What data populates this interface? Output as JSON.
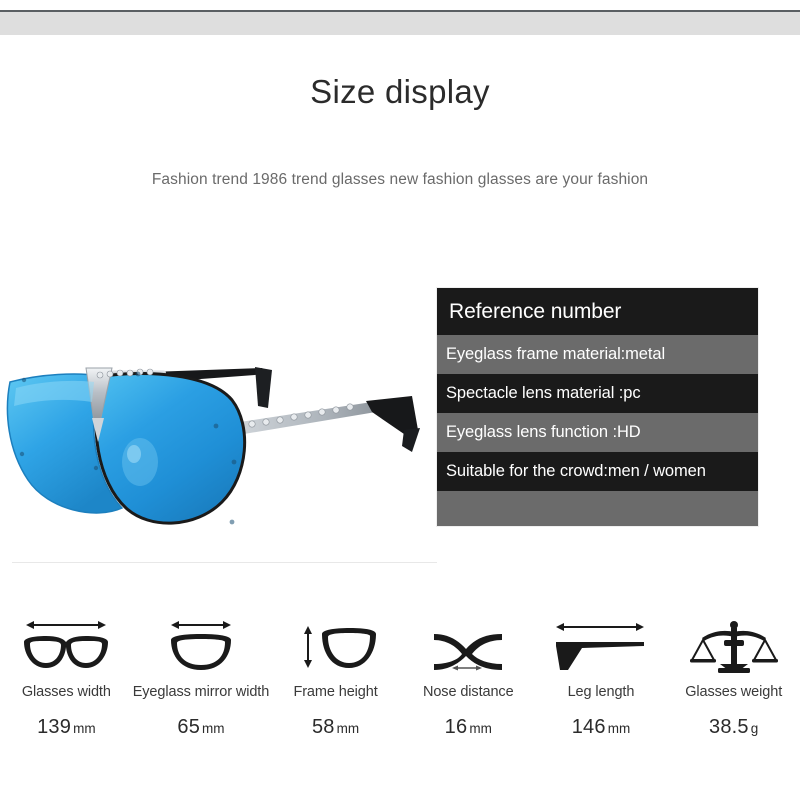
{
  "header": {
    "title": "Size display",
    "subtitle": "Fashion trend 1986 trend glasses new fashion glasses are your fashion"
  },
  "product": {
    "name": "blue mirrored shield sunglasses",
    "lens_color": "#2e9fe0",
    "frame_color": "#c9ccd1",
    "temple_tip_color": "#141414"
  },
  "spec_panel": {
    "heading": "Reference number",
    "rows": [
      {
        "text": "Eyeglass frame material:metal",
        "style": "gray"
      },
      {
        "text": "Spectacle lens material :pc",
        "style": "dark"
      },
      {
        "text": "Eyeglass lens function  :HD",
        "style": "gray"
      },
      {
        "text": "Suitable for the crowd:men / women",
        "style": "dark"
      },
      {
        "text": "",
        "style": "gray"
      }
    ],
    "colors": {
      "dark_row": "#1a1a1a",
      "gray_row": "#6b6b6b",
      "text": "#ffffff"
    }
  },
  "measurements": [
    {
      "icon": "glasses-frame-width-icon",
      "label": "Glasses width",
      "value": "139",
      "unit": "mm"
    },
    {
      "icon": "eyeglass-lens-width-icon",
      "label": "Eyeglass mirror width",
      "value": "65",
      "unit": "mm"
    },
    {
      "icon": "frame-height-icon",
      "label": "Frame height",
      "value": "58",
      "unit": "mm"
    },
    {
      "icon": "nose-bridge-icon",
      "label": "Nose distance",
      "value": "16",
      "unit": "mm"
    },
    {
      "icon": "temple-arm-icon",
      "label": "Leg length",
      "value": "146",
      "unit": "mm"
    },
    {
      "icon": "balance-scale-icon",
      "label": "Glasses weight",
      "value": "38.5",
      "unit": "g"
    }
  ]
}
